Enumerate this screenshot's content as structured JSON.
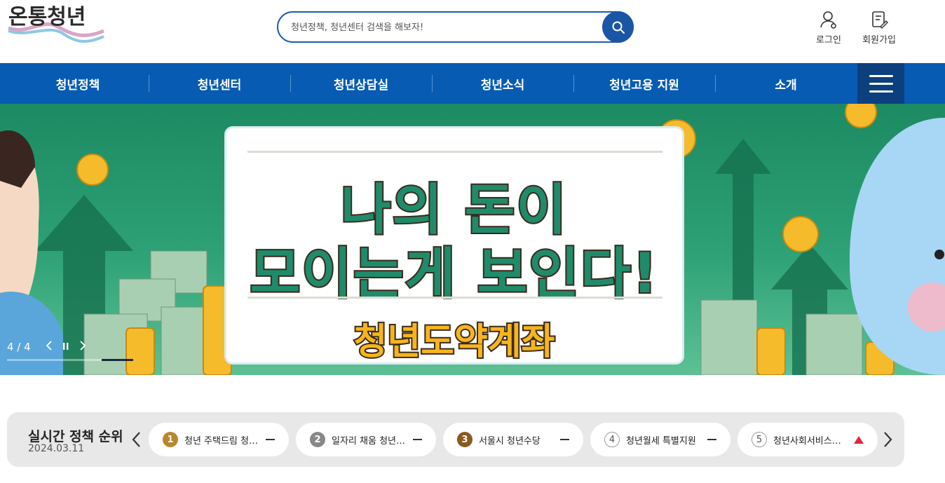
{
  "logo": {
    "text": "온통청년"
  },
  "search": {
    "placeholder": "청년정책, 청년센터 검색을 해보자!"
  },
  "util": {
    "login_label": "로그인",
    "signup_label": "회원가입"
  },
  "nav": {
    "items": [
      "청년정책",
      "청년센터",
      "청년상담실",
      "청년소식",
      "청년고용 지원",
      "소개"
    ]
  },
  "banner": {
    "headline_1": "나의 돈이",
    "headline_2": "모이는게 보인다!",
    "subtitle": "청년도약계좌",
    "counter": "4 / 4",
    "progress_fraction": 1.0
  },
  "ranking": {
    "title": "실시간 정책 순위",
    "date": "2024.03.11",
    "items": [
      {
        "rank": "1",
        "label": "청년 주택드림 청약통장",
        "trend": "same"
      },
      {
        "rank": "2",
        "label": "일자리 채움 청년지원금",
        "trend": "same"
      },
      {
        "rank": "3",
        "label": "서울시 청년수당",
        "trend": "same"
      },
      {
        "rank": "4",
        "label": "청년월세 특별지원",
        "trend": "same"
      },
      {
        "rank": "5",
        "label": "청년사회서비스사업단",
        "trend": "up"
      }
    ]
  },
  "colors": {
    "primary": "#075bb3",
    "menu_dark": "#0c3f7e",
    "banner_green": "#2ea176",
    "up_red": "#e0283c"
  }
}
